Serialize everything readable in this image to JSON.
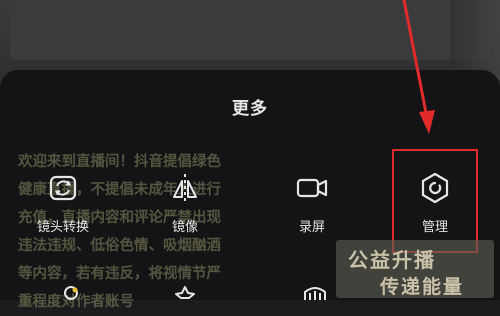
{
  "sheet": {
    "title": "更多"
  },
  "chat_overlay": {
    "lines": [
      "欢迎来到直播间！抖音提倡绿色",
      "健康直播，不提倡未成年人进行",
      "充值，直播内容和评论严禁出现",
      "违法违规、低俗色情、吸烟酗酒",
      "等内容，若有违反，将视情节严",
      "重程度对作者账号"
    ]
  },
  "menu": {
    "items": [
      {
        "label": "镜头转换",
        "icon": "camera-flip-icon"
      },
      {
        "label": "镜像",
        "icon": "mirror-icon"
      },
      {
        "label": "录屏",
        "icon": "video-record-icon"
      },
      {
        "label": "管理",
        "icon": "hexagon-settings-icon"
      }
    ]
  },
  "watermark": {
    "line1": "公益升播",
    "line2": "传递能量"
  },
  "colors": {
    "highlight": "#e12b2b",
    "sheet_bg": "#141416",
    "label_text": "#e6e6e6"
  }
}
